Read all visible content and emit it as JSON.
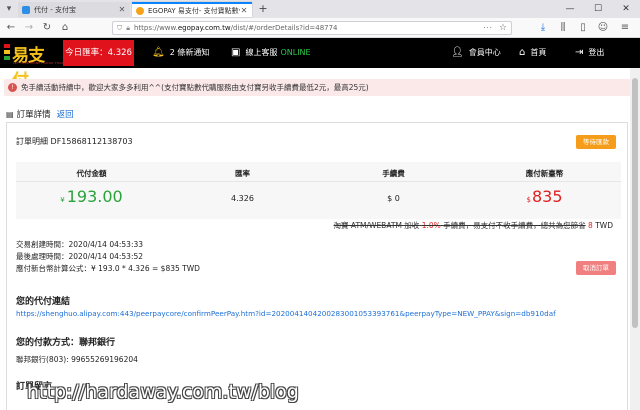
{
  "browser": {
    "tabs": [
      {
        "title": "代付 - 支付宝"
      },
      {
        "title": "EGOPAY 易支付- 支付寶點數代"
      }
    ],
    "url_prefix": "https://www.",
    "url_host": "egopay.com.tw",
    "url_path": "/dist/#/orderDetails?id=48774"
  },
  "header": {
    "logo": "易支付",
    "logo_subtitle": "LET YOUR MONEY GOOD THAN MORE",
    "rate_label": "今日匯率：4.326",
    "notifications": "2 條新通知",
    "support_label": "線上客服",
    "support_status": "ONLINE",
    "member": "會員中心",
    "home": "首頁",
    "logout": "登出"
  },
  "notice": {
    "text": "免手續活動持續中，歡迎大家多多利用^^(支付寶點數代購服務由支付寶另收手續費最低2元，最高25元)"
  },
  "page": {
    "title": "訂單詳情",
    "back": "返回"
  },
  "order": {
    "number_label": "訂單明細",
    "number": "DF15868112138703",
    "status": "等待匯款",
    "summary_headers": [
      "代付金額",
      "匯率",
      "手續費",
      "應付新臺幣"
    ],
    "amount_currency": "¥",
    "amount": "193.00",
    "rate": "4.326",
    "fee": "$ 0",
    "total_currency": "$",
    "total": "835",
    "discount_text": "淘寶 ATM/WEBATM 加收",
    "discount_pct": "1.0%",
    "discount_text2": "手續費，易支付不收手續費，總共為您節省",
    "discount_saved": "8",
    "discount_unit": "TWD",
    "created": "交易創建時間：2020/4/14 04:53:33",
    "updated": "最後處理時間：2020/4/14 04:53:52",
    "formula": "應付新台幣計算公式：¥ 193.0 * 4.326 = $835 TWD",
    "cancel": "取消訂單",
    "link_heading": "您的代付連結",
    "link": "https://shenghuo.alipay.com:443/peerpaycore/confirmPeerPay.htm?id=2020041404200283001053393761&peerpayType=NEW_PPAY&sign=db910daf",
    "payment_heading": "您的付款方式：聯邦銀行",
    "bank": "聯邦銀行(803): 99655269196204",
    "message_heading": "訂單留言"
  },
  "watermark": "http://hardaway.com.tw/blog"
}
